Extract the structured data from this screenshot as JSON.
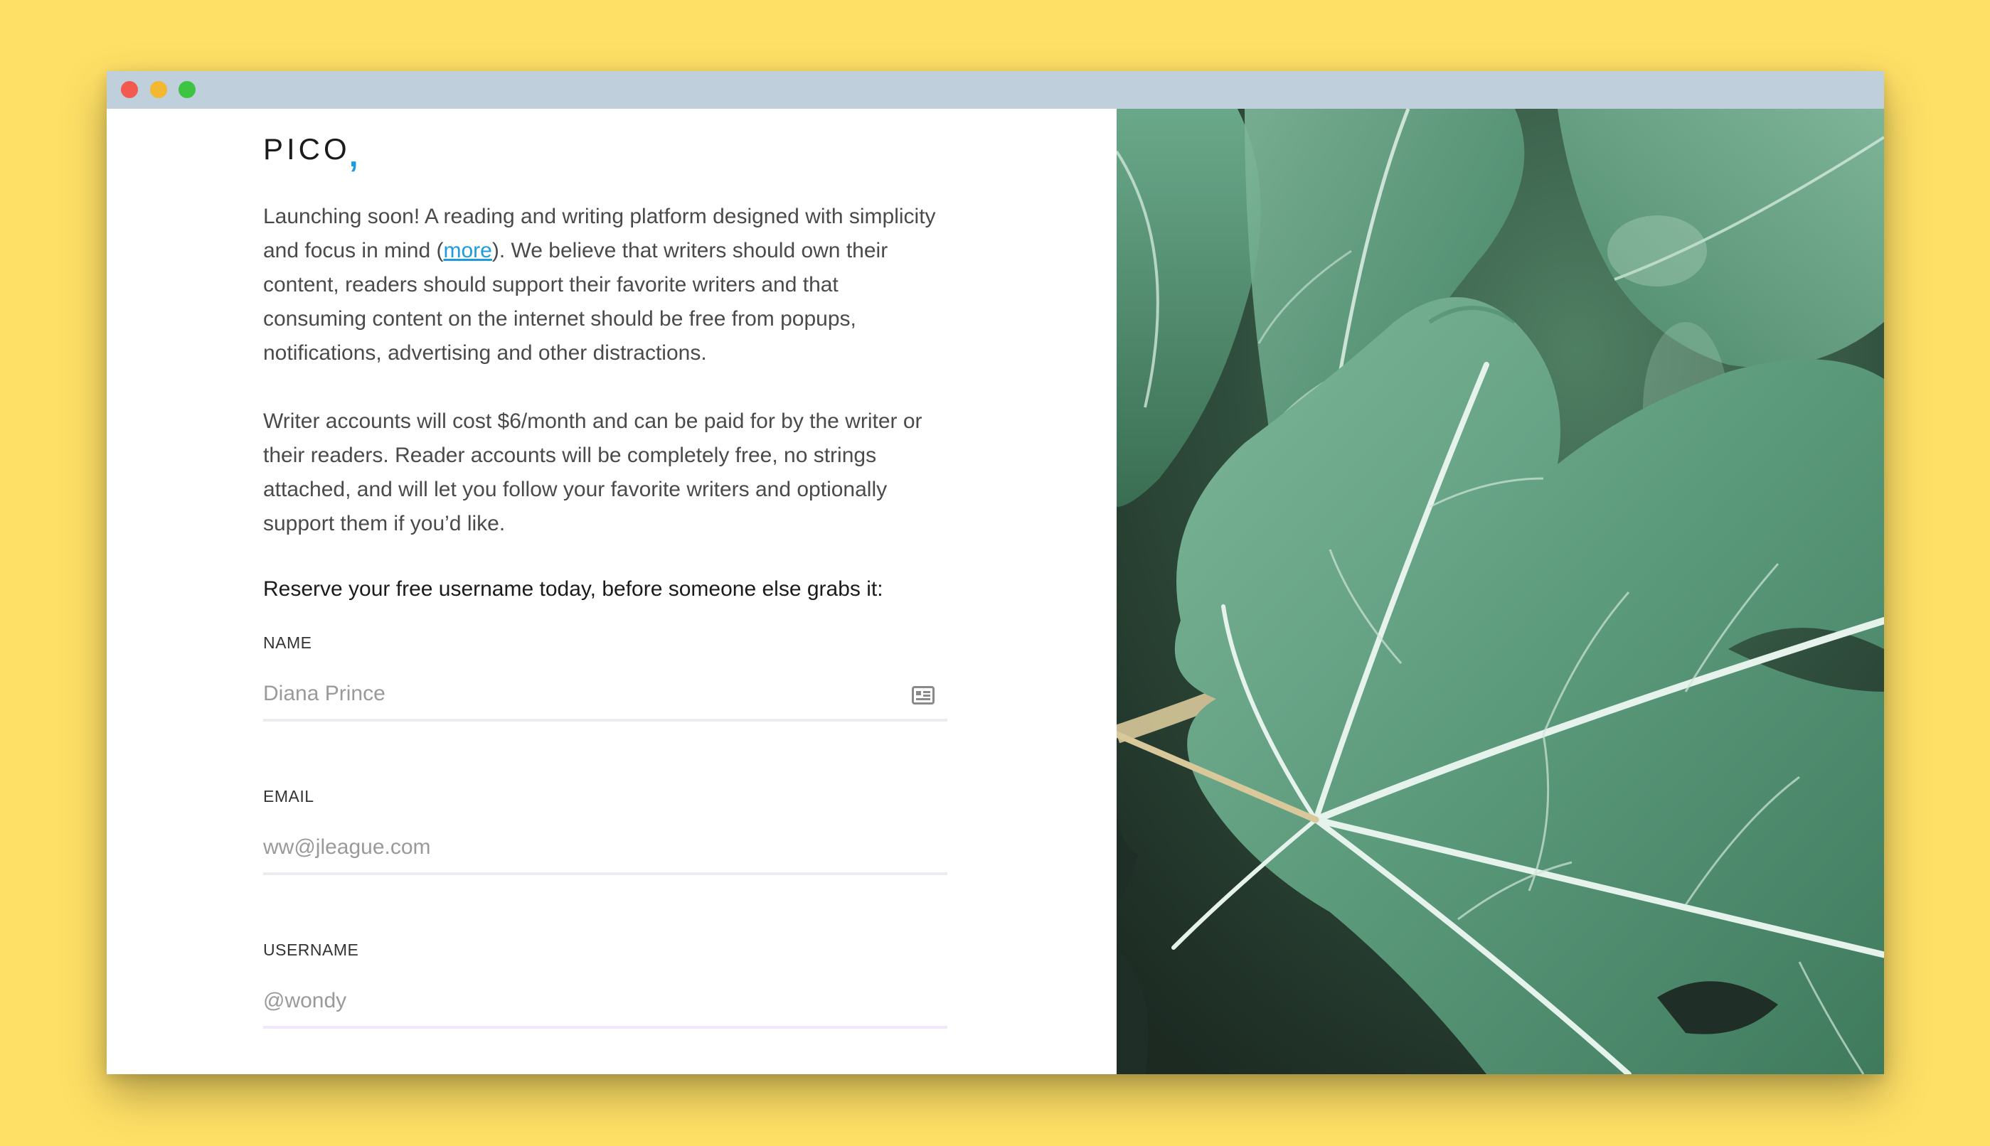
{
  "brand": {
    "name": "PICO",
    "punctuation": ",",
    "accent_color": "#1E9BE0"
  },
  "intro": {
    "before_link": "Launching soon! A reading and writing platform designed with simplicity and focus in mind (",
    "link_text": "more",
    "after_link": "). We believe that writers should own their content, readers should support their favorite writers and that consuming content on the internet should be free from popups, notifications, advertising and other distractions."
  },
  "pricing": "Writer accounts will cost $6/month and can be paid for by the writer or their readers. Reader accounts will be completely free, no strings attached, and will let you follow your favorite writers and optionally support them if you’d like.",
  "cta": "Reserve your free username today, before someone else grabs it:",
  "form": {
    "name": {
      "label": "NAME",
      "placeholder": "Diana Prince",
      "icon": "contact-card-icon"
    },
    "email": {
      "label": "EMAIL",
      "placeholder": "ww@jleague.com"
    },
    "username": {
      "label": "USERNAME",
      "placeholder": "@wondy"
    }
  },
  "photo": {
    "subject": "fig-leaf-photo"
  },
  "colors": {
    "background": "#FFE066",
    "titlebar": "#BFCFDB",
    "leaf": "#5E9E80"
  }
}
